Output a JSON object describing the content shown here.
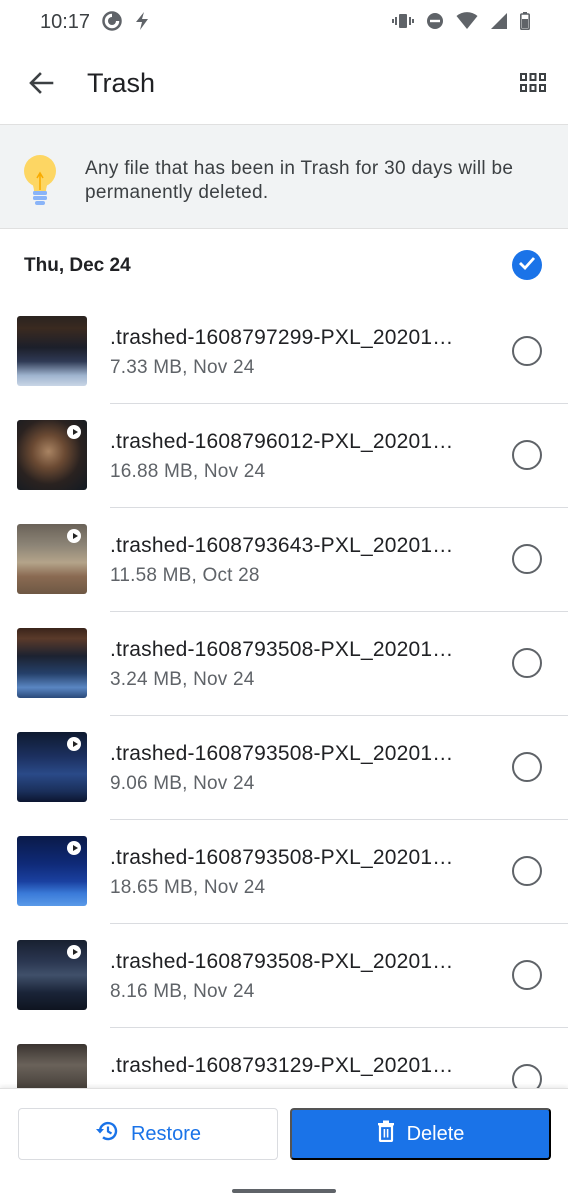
{
  "status_bar": {
    "time": "10:17",
    "left_icons": [
      "data-saver-icon",
      "flash-icon"
    ],
    "right_icons": [
      "vibrate-icon",
      "do-not-disturb-icon",
      "wifi-icon",
      "signal-icon",
      "battery-icon"
    ]
  },
  "app_bar": {
    "title": "Trash",
    "back_icon": "arrow-back-icon",
    "view_icon": "grid-view-icon"
  },
  "banner": {
    "icon": "lightbulb-icon",
    "text": "Any file that has been in Trash for 30 days will be permanently deleted."
  },
  "section": {
    "title": "Thu, Dec 24",
    "all_selected": true
  },
  "files": [
    {
      "name": ".trashed-1608797299-PXL_20201…",
      "meta": "7.33 MB, Nov 24",
      "video": false
    },
    {
      "name": ".trashed-1608796012-PXL_20201…",
      "meta": "16.88 MB, Nov 24",
      "video": true
    },
    {
      "name": ".trashed-1608793643-PXL_20201…",
      "meta": "11.58 MB, Oct 28",
      "video": true
    },
    {
      "name": ".trashed-1608793508-PXL_20201…",
      "meta": "3.24 MB, Nov 24",
      "video": false
    },
    {
      "name": ".trashed-1608793508-PXL_20201…",
      "meta": "9.06 MB, Nov 24",
      "video": true
    },
    {
      "name": ".trashed-1608793508-PXL_20201…",
      "meta": "18.65 MB, Nov 24",
      "video": true
    },
    {
      "name": ".trashed-1608793508-PXL_20201…",
      "meta": "8.16 MB, Nov 24",
      "video": true
    },
    {
      "name": ".trashed-1608793129-PXL_20201…",
      "meta": "",
      "video": false
    }
  ],
  "actions": {
    "restore_label": "Restore",
    "restore_icon": "history-icon",
    "delete_label": "Delete",
    "delete_icon": "trash-icon"
  },
  "colors": {
    "accent": "#1a73e8",
    "banner_bg": "#f1f3f4",
    "text_primary": "#202124",
    "text_secondary": "#5f6368"
  }
}
